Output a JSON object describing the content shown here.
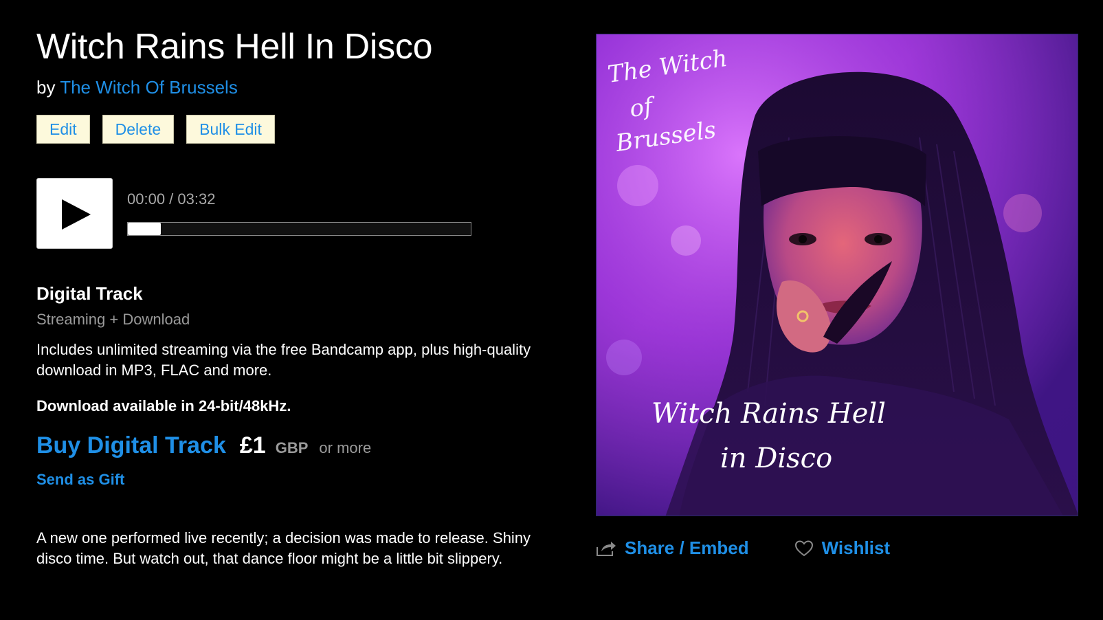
{
  "track": {
    "title": "Witch Rains Hell In Disco",
    "by_prefix": "by ",
    "artist": "The Witch Of Brussels"
  },
  "admin_buttons": {
    "edit": "Edit",
    "delete": "Delete",
    "bulk_edit": "Bulk Edit"
  },
  "player": {
    "time": "00:00 / 03:32",
    "play_icon": "play-icon"
  },
  "digital": {
    "title": "Digital Track",
    "subtitle": "Streaming + Download",
    "description": "Includes unlimited streaming via the free Bandcamp app, plus high-quality download in MP3, FLAC and more.",
    "note": "Download available in 24-bit/48kHz."
  },
  "purchase": {
    "buy_label": "Buy Digital Track",
    "price": "£1",
    "currency": "GBP",
    "or_more": "or more",
    "gift_label": "Send as Gift"
  },
  "about": "A new one performed live recently; a decision was made to release. Shiny disco time. But watch out, that dance floor might be a little bit slippery.",
  "artwork": {
    "handwriting_top": [
      "The Witch",
      "of",
      "Brussels"
    ],
    "handwriting_bottom": [
      "Witch Rains Hell",
      "in Disco"
    ]
  },
  "actions": {
    "share_label": "Share / Embed",
    "share_icon": "share-icon",
    "wishlist_label": "Wishlist",
    "wishlist_icon": "heart-icon"
  },
  "colors": {
    "accent": "#1f8fe6",
    "background": "#000000",
    "button_bg": "#fdf9dc",
    "muted": "#9a9a9a"
  }
}
